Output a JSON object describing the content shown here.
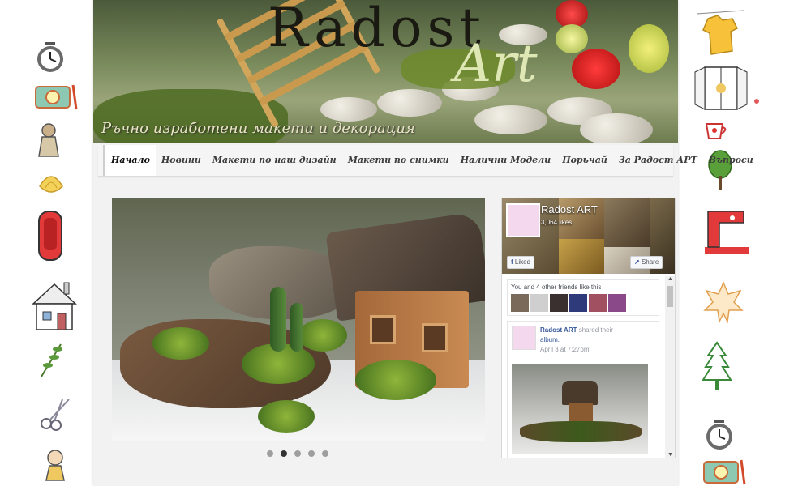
{
  "header": {
    "logo_main": "Radost",
    "logo_script": "Art",
    "tagline": "Ръчно изработени макети и декорация"
  },
  "nav": {
    "items": [
      {
        "label": "Начало",
        "active": true
      },
      {
        "label": "Новини",
        "active": false
      },
      {
        "label": "Макети по наш дизайн",
        "active": false
      },
      {
        "label": "Макети по снимки",
        "active": false
      },
      {
        "label": "Налични Модели",
        "active": false
      },
      {
        "label": "Порьчай",
        "active": false
      },
      {
        "label": "За Радост АРТ",
        "active": false
      },
      {
        "label": "Въпроси",
        "active": false
      }
    ]
  },
  "slider": {
    "slide_count": 5,
    "active_index": 1
  },
  "facebook": {
    "page_name": "Radost ART",
    "likes": "3,064 likes",
    "liked_label": "Liked",
    "share_label": "Share",
    "friends_text": "You and 4 other friends like this",
    "post": {
      "author": "Radost ART",
      "action": "shared their",
      "object": "album.",
      "date": "April 3 at 7:27pm"
    }
  },
  "decorations": {
    "left": [
      "clock-icon",
      "camera-icon",
      "doll-icon",
      "shell-icon",
      "toaster-icon",
      "house-icon",
      "branch-icon",
      "scissors-icon",
      "baby-icon"
    ],
    "right": [
      "dress-icon",
      "window-icon",
      "cup-icon",
      "tree-icon",
      "sewing-machine-icon",
      "leaf-icon",
      "pine-tree-icon",
      "clock-icon",
      "camera-icon"
    ]
  },
  "colors": {
    "page_bg": "#f2f2f2",
    "nav_bg": "#f5f5f5",
    "fb_link": "#365899",
    "accent_red": "#d93a3a"
  }
}
